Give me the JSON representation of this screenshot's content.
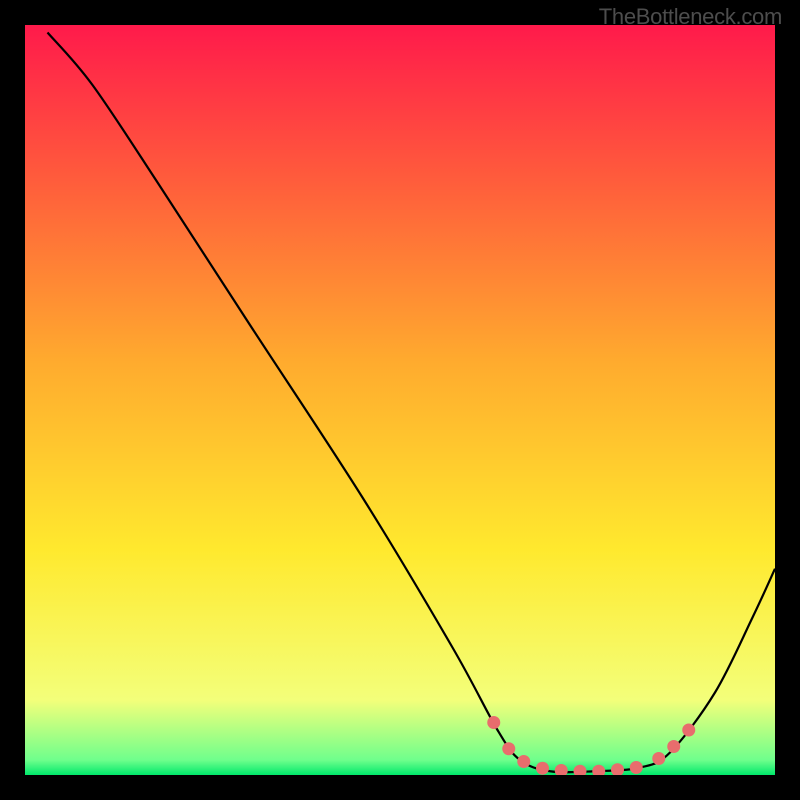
{
  "watermark": "TheBottleneck.com",
  "chart_data": {
    "type": "line",
    "title": "",
    "xlabel": "",
    "ylabel": "",
    "xlim": [
      0,
      100
    ],
    "ylim": [
      0,
      100
    ],
    "gradient_stops": [
      {
        "offset": 0,
        "color": "#ff1a4b"
      },
      {
        "offset": 20,
        "color": "#ff5a3c"
      },
      {
        "offset": 45,
        "color": "#ffab2e"
      },
      {
        "offset": 70,
        "color": "#ffe92e"
      },
      {
        "offset": 90,
        "color": "#f3ff7a"
      },
      {
        "offset": 98,
        "color": "#6fff8c"
      },
      {
        "offset": 100,
        "color": "#00e86b"
      }
    ],
    "curve": [
      {
        "x": 3.0,
        "y": 99.0
      },
      {
        "x": 9.0,
        "y": 92.0
      },
      {
        "x": 18.0,
        "y": 78.5
      },
      {
        "x": 30.0,
        "y": 60.0
      },
      {
        "x": 45.0,
        "y": 37.0
      },
      {
        "x": 57.0,
        "y": 17.0
      },
      {
        "x": 63.0,
        "y": 6.0
      },
      {
        "x": 66.0,
        "y": 2.0
      },
      {
        "x": 70.0,
        "y": 0.5
      },
      {
        "x": 76.0,
        "y": 0.5
      },
      {
        "x": 82.0,
        "y": 1.0
      },
      {
        "x": 86.0,
        "y": 3.0
      },
      {
        "x": 92.0,
        "y": 11.0
      },
      {
        "x": 97.0,
        "y": 21.0
      },
      {
        "x": 100.0,
        "y": 27.5
      }
    ],
    "markers": [
      {
        "x": 62.5,
        "y": 7.0
      },
      {
        "x": 64.5,
        "y": 3.5
      },
      {
        "x": 66.5,
        "y": 1.8
      },
      {
        "x": 69.0,
        "y": 0.9
      },
      {
        "x": 71.5,
        "y": 0.6
      },
      {
        "x": 74.0,
        "y": 0.5
      },
      {
        "x": 76.5,
        "y": 0.5
      },
      {
        "x": 79.0,
        "y": 0.7
      },
      {
        "x": 81.5,
        "y": 1.0
      },
      {
        "x": 84.5,
        "y": 2.2
      },
      {
        "x": 86.5,
        "y": 3.8
      },
      {
        "x": 88.5,
        "y": 6.0
      }
    ],
    "marker_color": "#e86d6d",
    "curve_color": "#000000"
  }
}
